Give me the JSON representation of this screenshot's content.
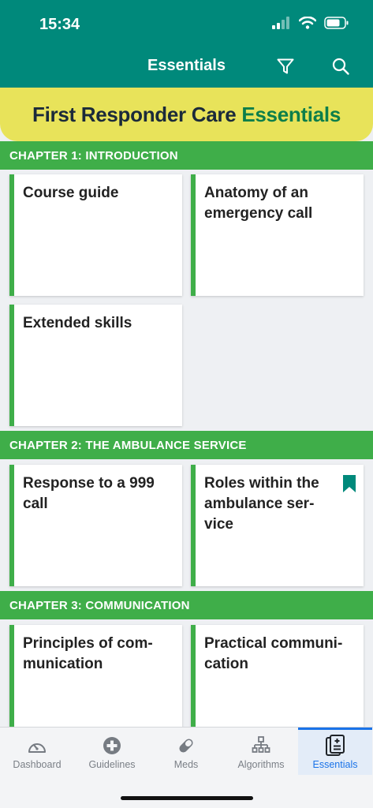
{
  "status_bar": {
    "time": "15:34"
  },
  "header": {
    "title": "Essentials"
  },
  "banner": {
    "title_part1": "First Responder Care",
    "title_part2": "Essentials"
  },
  "chapters": [
    {
      "title": "CHAPTER 1: INTRODUCTION",
      "cards": [
        {
          "title": "Course guide",
          "bookmarked": false
        },
        {
          "title": "Anatomy of an emergency call",
          "bookmarked": false
        },
        {
          "title": "Extended skills",
          "bookmarked": false
        }
      ]
    },
    {
      "title": "CHAPTER 2: THE AMBULANCE SERVICE",
      "cards": [
        {
          "title": "Response to a 999 call",
          "bookmarked": false
        },
        {
          "title": "Roles within the ambulance ser-vice",
          "bookmarked": true
        }
      ]
    },
    {
      "title": "CHAPTER 3: COMMUNICATION",
      "cards": [
        {
          "title": "Principles of com-munication",
          "bookmarked": false
        },
        {
          "title": "Practical communi-cation",
          "bookmarked": false
        }
      ]
    }
  ],
  "tabbar": {
    "items": [
      {
        "label": "Dashboard",
        "icon": "gauge-icon",
        "active": false
      },
      {
        "label": "Guidelines",
        "icon": "medical-cross-icon",
        "active": false
      },
      {
        "label": "Meds",
        "icon": "pill-icon",
        "active": false
      },
      {
        "label": "Algorithms",
        "icon": "flowchart-icon",
        "active": false
      },
      {
        "label": "Essentials",
        "icon": "document-icon",
        "active": true
      }
    ]
  },
  "colors": {
    "header": "#00897b",
    "banner": "#e8e35a",
    "chapter": "#3fae49",
    "accent": "#1a73e8"
  }
}
